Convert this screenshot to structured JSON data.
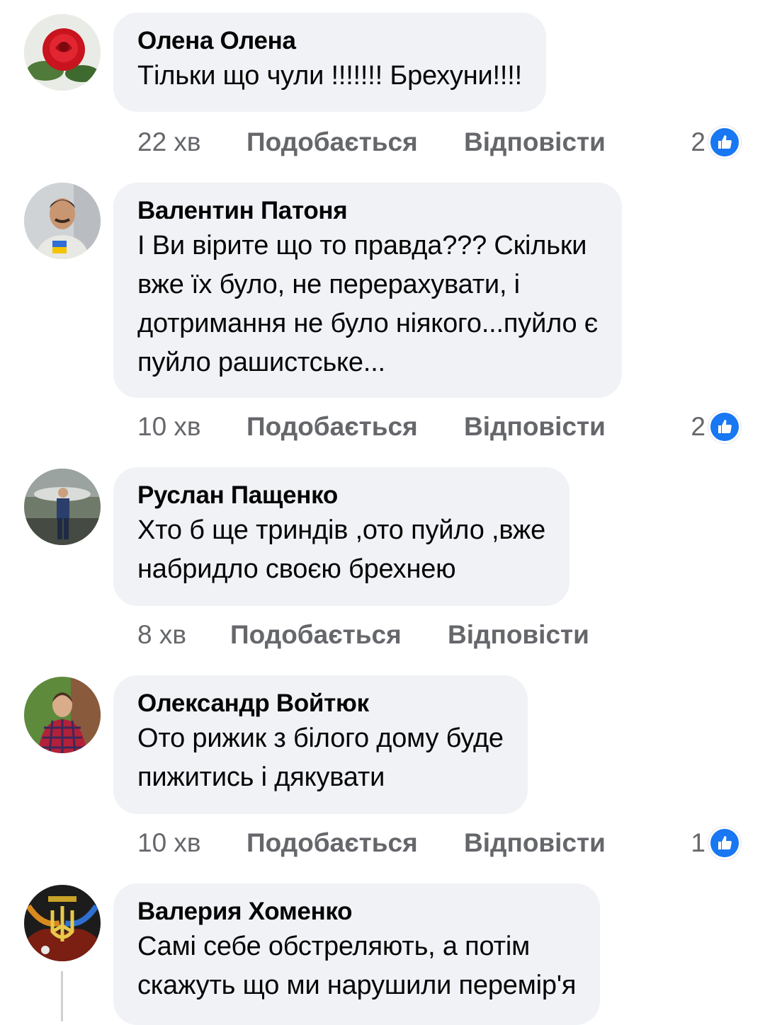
{
  "colors": {
    "bubble": "#f0f2f5",
    "meta_text": "#65676b",
    "like_blue": "#1877f2"
  },
  "comments": [
    {
      "author": "Олена Олена",
      "text": "Тільки що чули !!!!!!! Брехуни!!!!",
      "time": "22 хв",
      "like_label": "Подобається",
      "reply_label": "Відповісти",
      "reactions": "2",
      "reaction_icon": "thumbs-up-icon",
      "avatar": "rose-avatar"
    },
    {
      "author": "Валентин Патоня",
      "text": "І Ви вірите що то правда??? Скільки\nвже їх було, не перерахувати, і\nдотримання не було ніякого...пуйло є\nпуйло рашистське...",
      "time": "10 хв",
      "like_label": "Подобається",
      "reply_label": "Відповісти",
      "reactions": "2",
      "reaction_icon": "thumbs-up-icon",
      "avatar": "man-portrait-avatar"
    },
    {
      "author": "Руслан Пащенко",
      "text": "Хто б ще триндів ,ото пуйло ,вже\nнабридло своєю брехнею",
      "time": "8 хв",
      "like_label": "Подобається",
      "reply_label": "Відповісти",
      "reactions": "",
      "reaction_icon": "",
      "avatar": "man-outdoor-avatar"
    },
    {
      "author": "Олександр Войтюк",
      "text": "Ото рижик з білого дому буде\nпижитись і дякувати",
      "time": "10 хв",
      "like_label": "Подобається",
      "reply_label": "Відповісти",
      "reactions": "1",
      "reaction_icon": "thumbs-up-icon",
      "avatar": "man-plaid-shirt-avatar"
    },
    {
      "author": "Валерия Хоменко",
      "text": "Самі себе обстреляють,  а потім\nскажуть що ми нарушили перемір'я",
      "time": "",
      "like_label": "",
      "reply_label": "",
      "reactions": "",
      "reaction_icon": "",
      "avatar": "trident-emblem-avatar"
    }
  ]
}
